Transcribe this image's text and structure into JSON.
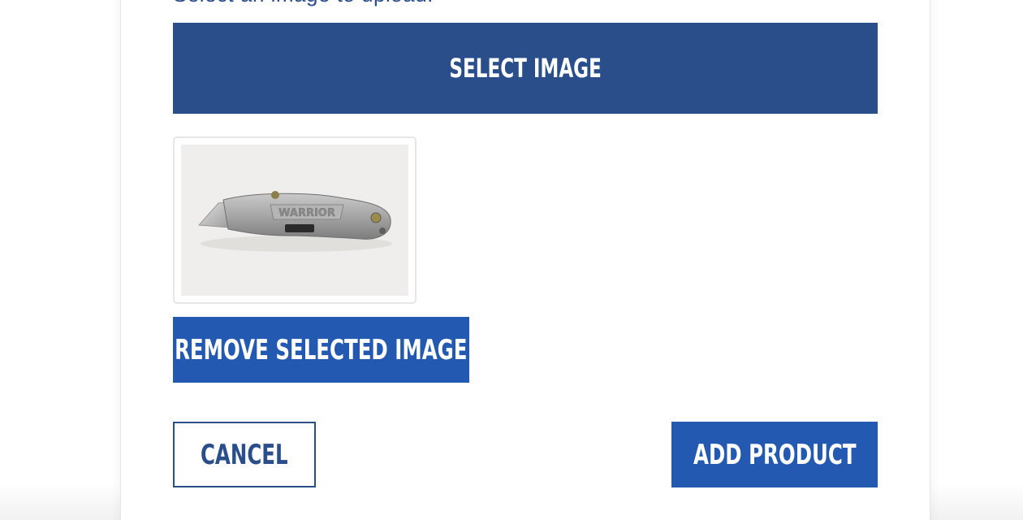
{
  "form": {
    "upload_label": "Select an image to upload:",
    "select_image_label": "SELECT IMAGE",
    "preview_image_alt": "utility knife",
    "preview_brand_text": "WARRIOR",
    "remove_image_label": "REMOVE SELECTED IMAGE",
    "cancel_label": "CANCEL",
    "add_product_label": "ADD PRODUCT"
  },
  "colors": {
    "primary_dark": "#2a4e8a",
    "primary": "#2359b0",
    "border": "#e6e6e6"
  }
}
